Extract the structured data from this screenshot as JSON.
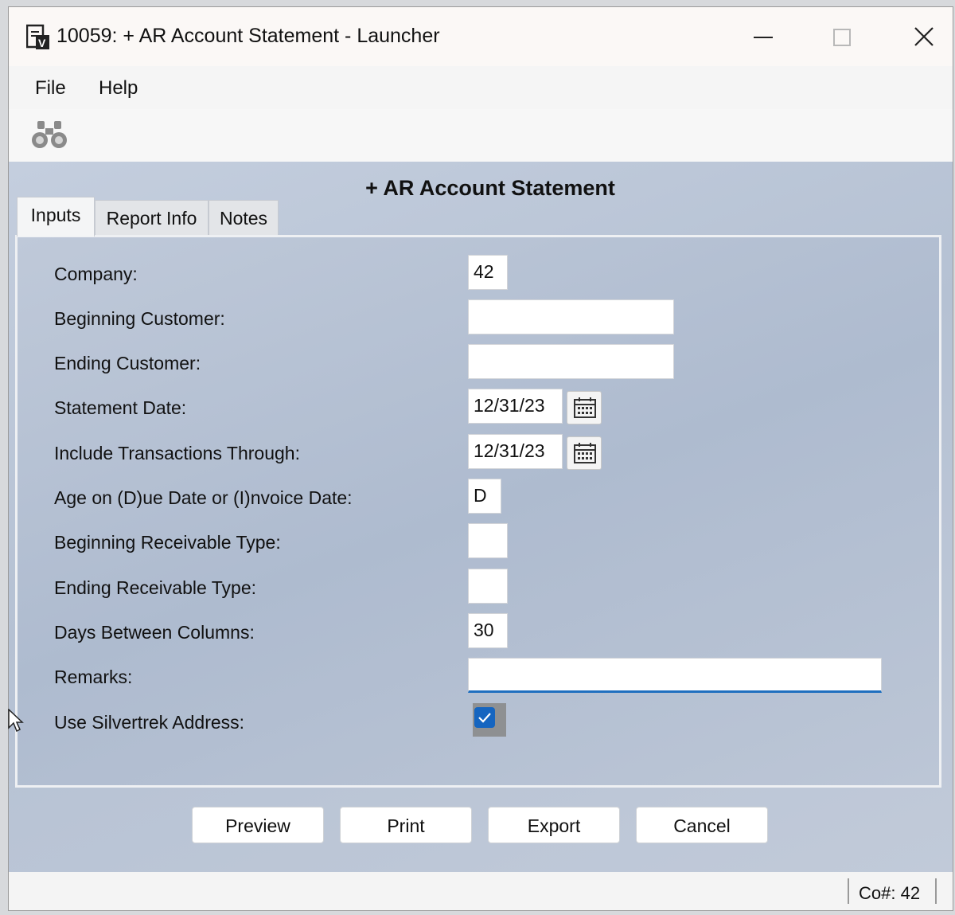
{
  "window": {
    "title": "10059: + AR Account Statement - Launcher"
  },
  "menu": {
    "file": "File",
    "help": "Help"
  },
  "toolbar": {
    "find_icon": "binoculars-icon"
  },
  "form": {
    "title": "+ AR Account Statement"
  },
  "tabs": [
    {
      "label": "Inputs",
      "active": true
    },
    {
      "label": "Report Info",
      "active": false
    },
    {
      "label": "Notes",
      "active": false
    }
  ],
  "fields": {
    "company": {
      "label": "Company:",
      "value": "42"
    },
    "beginning_customer": {
      "label": "Beginning Customer:",
      "value": ""
    },
    "ending_customer": {
      "label": "Ending Customer:",
      "value": ""
    },
    "statement_date": {
      "label": "Statement Date:",
      "value": "12/31/23"
    },
    "include_through": {
      "label": "Include Transactions Through:",
      "value": "12/31/23"
    },
    "age_on": {
      "label": "Age on (D)ue Date or (I)nvoice Date:",
      "value": "D"
    },
    "beginning_receivable_type": {
      "label": "Beginning Receivable Type:",
      "value": ""
    },
    "ending_receivable_type": {
      "label": "Ending Receivable Type:",
      "value": ""
    },
    "days_between_columns": {
      "label": "Days Between Columns:",
      "value": "30"
    },
    "remarks": {
      "label": "Remarks:",
      "value": ""
    },
    "use_silvertrek_address": {
      "label": "Use Silvertrek Address:",
      "checked": true
    }
  },
  "buttons": {
    "preview": "Preview",
    "print": "Print",
    "export": "Export",
    "cancel": "Cancel"
  },
  "status": {
    "company": "Co#: 42"
  },
  "colors": {
    "accent": "#1565c0",
    "panel": "#b5c1d3"
  }
}
